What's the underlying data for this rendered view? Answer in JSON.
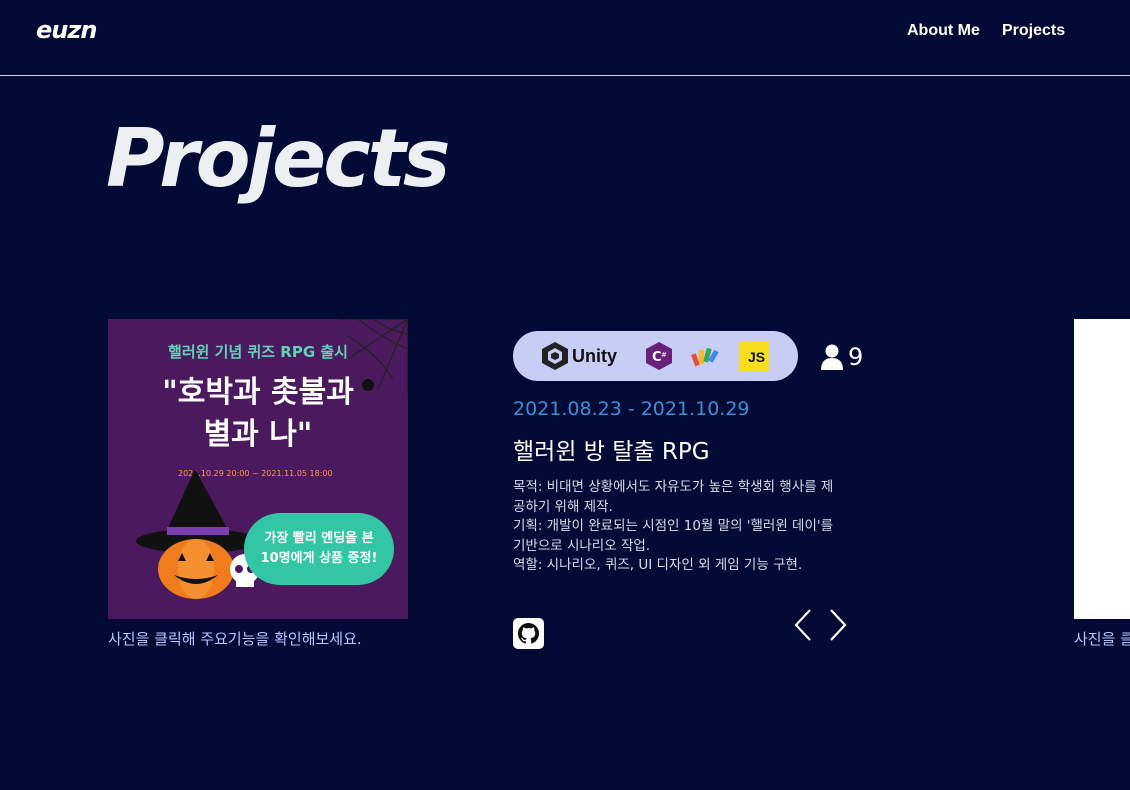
{
  "nav": {
    "logo": "euzn",
    "links": [
      "About Me",
      "Projects"
    ]
  },
  "page": {
    "title": "Projects"
  },
  "project": {
    "poster": {
      "subtitle": "핼러윈 기념 퀴즈 RPG 출시",
      "title_line1": "\"호박과 촛불과",
      "title_line2": "별과 나\"",
      "date": "2021.10.29  20:00 ~ 2021.11.05  18:00",
      "bubble_line1": "가장 빨리 엔딩을 본",
      "bubble_line2": "10명에게 상품 증정!"
    },
    "caption": "사진을 클릭해 주요기능을 확인해보세요.",
    "stack": {
      "unity_label": "Unity",
      "js_label": "JS",
      "icons": [
        "unity-icon",
        "csharp-icon",
        "figma-like-icon",
        "javascript-icon"
      ]
    },
    "members": "9",
    "date_range": "2021.08.23 - 2021.10.29",
    "title": "핼러윈 방 탈출 RPG",
    "description": [
      "목적: 비대면 상황에서도 자유도가 높은 학생회 행사를 제",
      "공하기 위해 제작.",
      "기획: 개발이 완료되는 시점인 10월 말의 '핼러윈 데이'를",
      "기반으로 시나리오 작업.",
      "역할: 시나리오, 퀴즈, UI 디자인 외 게임 기능 구현."
    ]
  },
  "next_caption": "사진을 클",
  "colors": {
    "background": "#020a35",
    "accent_date": "#3b8fd6",
    "pill": "#c8cdf6",
    "caption": "#b8c6ff"
  }
}
